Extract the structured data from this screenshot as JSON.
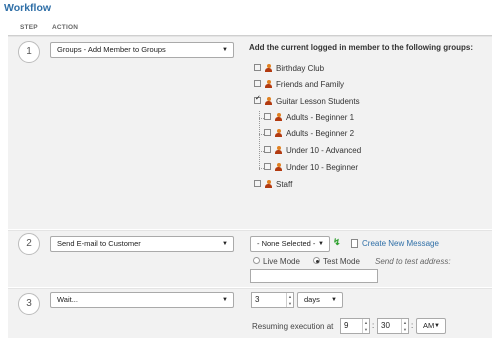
{
  "title": "Workflow",
  "headers": {
    "step": "STEP",
    "action": "ACTION"
  },
  "steps": [
    {
      "number": "1",
      "action": "Groups - Add Member to Groups",
      "groups_title": "Add the current logged in member to the following groups:",
      "groups": [
        {
          "label": "Birthday Club",
          "checked": false
        },
        {
          "label": "Friends and Family",
          "checked": false
        },
        {
          "label": "Guitar Lesson Students",
          "checked": true
        },
        {
          "label": "Adults - Beginner 1",
          "checked": false
        },
        {
          "label": "Adults - Beginner 2",
          "checked": false
        },
        {
          "label": "Under 10 - Advanced",
          "checked": false
        },
        {
          "label": "Under 10 - Beginner",
          "checked": false
        },
        {
          "label": "Staff",
          "checked": false
        }
      ]
    },
    {
      "number": "2",
      "action": "Send E-mail to Customer",
      "message_select": "- None Selected -",
      "create_link": "Create New Message",
      "live_mode": "Live Mode",
      "test_mode": "Test Mode",
      "send_to_label": "Send to test address:",
      "test_address": ""
    },
    {
      "number": "3",
      "action": "Wait...",
      "amount": "3",
      "unit": "days",
      "resume_label": "Resuming execution at",
      "hour": "9",
      "minute": "30",
      "ampm": "AM"
    }
  ]
}
